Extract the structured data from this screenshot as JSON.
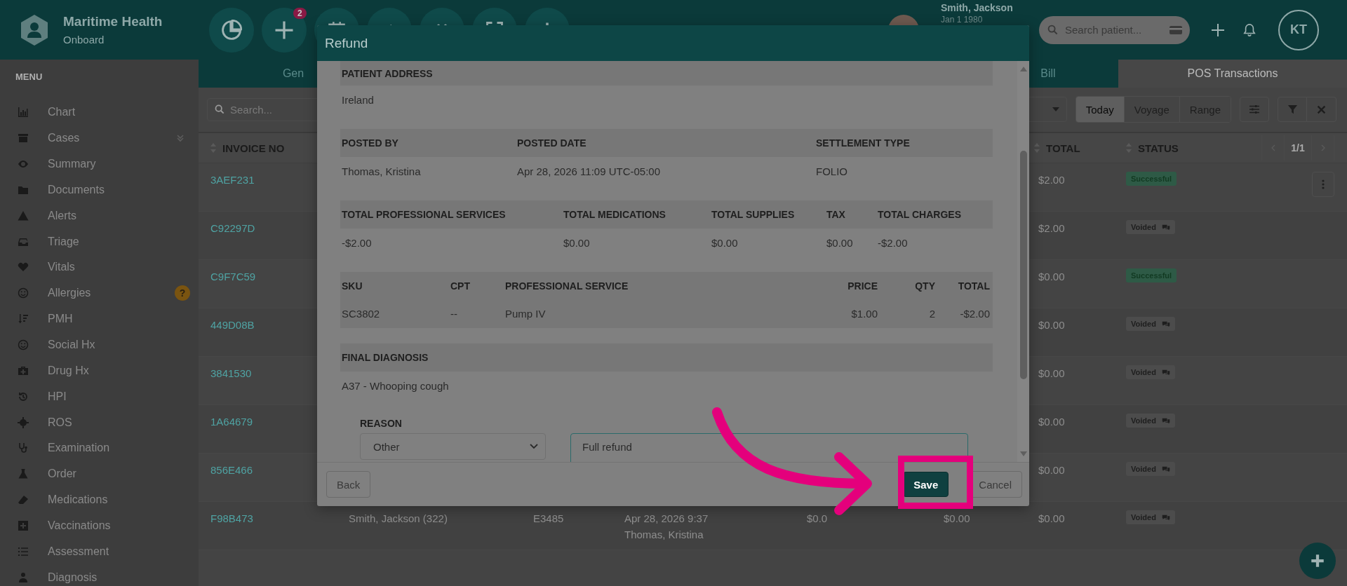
{
  "app": {
    "name": "Maritime Health",
    "subtitle": "Onboard"
  },
  "toolbar": {
    "badge": "2"
  },
  "patient": {
    "name": "Smith, Jackson",
    "dob": "Jan 1 1980"
  },
  "search": {
    "placeholder": "Search patient..."
  },
  "user": {
    "initials": "KT"
  },
  "sidebar": {
    "title": "MENU",
    "items": [
      {
        "label": "Chart"
      },
      {
        "label": "Cases",
        "expandable": true
      },
      {
        "label": "Summary"
      },
      {
        "label": "Documents"
      },
      {
        "label": "Alerts"
      },
      {
        "label": "Triage"
      },
      {
        "label": "Vitals"
      },
      {
        "label": "Allergies",
        "badge": "?"
      },
      {
        "label": "PMH"
      },
      {
        "label": "Social Hx"
      },
      {
        "label": "Drug Hx"
      },
      {
        "label": "HPI"
      },
      {
        "label": "ROS"
      },
      {
        "label": "Examination"
      },
      {
        "label": "Order"
      },
      {
        "label": "Medications"
      },
      {
        "label": "Vaccinations"
      },
      {
        "label": "Assessment"
      },
      {
        "label": "Diagnosis"
      }
    ]
  },
  "tabs": [
    {
      "label": "Gen",
      "selected": false
    },
    {
      "label": "Bill",
      "selected": false
    },
    {
      "label": "POS Transactions",
      "selected": true
    }
  ],
  "filters": {
    "search_placeholder": "Search...",
    "ranges": [
      {
        "label": "Today",
        "selected": true
      },
      {
        "label": "Voyage",
        "selected": false
      },
      {
        "label": "Range",
        "selected": false
      }
    ]
  },
  "table": {
    "columns": [
      "INVOICE NO",
      "TOTAL",
      "STATUS"
    ],
    "pager": "1/1",
    "rows": [
      {
        "invoice": "3AEF231",
        "total": "$2.00",
        "status": {
          "label": "Successful",
          "kind": "success"
        },
        "menu": true
      },
      {
        "invoice": "C92297D",
        "total": "$2.00",
        "status": {
          "label": "Voided",
          "kind": "voided"
        }
      },
      {
        "invoice": "C9F7C59",
        "total": "$0.00",
        "status": {
          "label": "Successful",
          "kind": "success"
        }
      },
      {
        "invoice": "449D08B",
        "total": "$0.00",
        "status": {
          "label": "Voided",
          "kind": "voided"
        }
      },
      {
        "invoice": "3841530",
        "total": "$0.00",
        "status": {
          "label": "Voided",
          "kind": "voided"
        }
      },
      {
        "invoice": "1A64679",
        "total": "$0.00",
        "status": {
          "label": "Voided",
          "kind": "voided"
        }
      },
      {
        "invoice": "856E466",
        "total": "$0.00",
        "status": {
          "label": "Voided",
          "kind": "voided"
        }
      },
      {
        "invoice": "F98B473",
        "cells": [
          [
            "Smith, Jackson (322)"
          ],
          [
            "E3485"
          ],
          [
            "Apr 28, 2026 9:37",
            "Thomas, Kristina"
          ],
          [
            "$0.0"
          ],
          [
            "$0.00"
          ]
        ],
        "total": "$0.00",
        "status": {
          "label": "Voided",
          "kind": "voided"
        }
      }
    ]
  },
  "modal": {
    "title": "Refund",
    "sections": [
      {
        "kind": "address",
        "headers": [
          "PATIENT ADDRESS"
        ],
        "values": [
          "Ireland"
        ]
      },
      {
        "kind": "posting",
        "headers": [
          "POSTED BY",
          "POSTED DATE",
          "SETTLEMENT TYPE"
        ],
        "values": [
          "Thomas, Kristina",
          "Apr 28, 2026 11:09 UTC-05:00",
          "FOLIO"
        ]
      },
      {
        "kind": "totals",
        "headers": [
          "TOTAL PROFESSIONAL SERVICES",
          "TOTAL MEDICATIONS",
          "TOTAL SUPPLIES",
          "TAX",
          "TOTAL CHARGES"
        ],
        "values": [
          "-$2.00",
          "$0.00",
          "$0.00",
          "$0.00",
          "-$2.00"
        ]
      },
      {
        "kind": "items",
        "headers": [
          "SKU",
          "CPT",
          "PROFESSIONAL SERVICE",
          "PRICE",
          "QTY",
          "TOTAL"
        ],
        "values": [
          "SC3802",
          "--",
          "Pump IV",
          "$1.00",
          "2",
          "-$2.00"
        ]
      },
      {
        "kind": "diagnosis",
        "headers": [
          "FINAL DIAGNOSIS"
        ],
        "values": [
          "A37 - Whooping cough"
        ]
      }
    ],
    "reason": {
      "label": "REASON",
      "value": "Other",
      "note": "Full refund"
    },
    "buttons": [
      {
        "label": "Back",
        "kind": "secondary"
      },
      {
        "label": "Save",
        "kind": "primary"
      },
      {
        "label": "Cancel",
        "kind": "secondary"
      }
    ]
  }
}
